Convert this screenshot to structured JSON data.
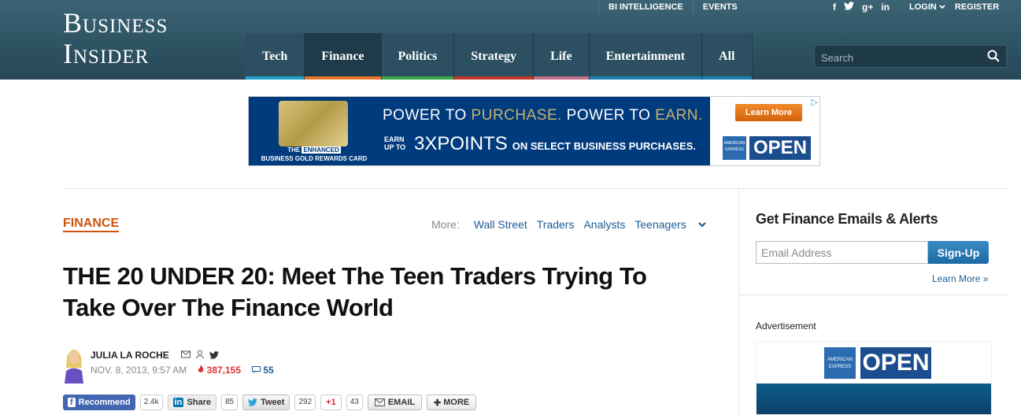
{
  "header": {
    "logo_line1": "Business",
    "logo_line2": "Insider",
    "top_links": [
      "BI INTELLIGENCE",
      "EVENTS"
    ],
    "social": [
      "f",
      "t",
      "g+",
      "in"
    ],
    "login": "LOGIN",
    "register": "REGISTER",
    "nav": [
      {
        "label": "Tech",
        "color": "#1fa0c8"
      },
      {
        "label": "Finance",
        "color": "#e8752a"
      },
      {
        "label": "Politics",
        "color": "#3aa44a"
      },
      {
        "label": "Strategy",
        "color": "#c0392b"
      },
      {
        "label": "Life",
        "color": "#c4708a"
      },
      {
        "label": "Entertainment",
        "color": "#1f7fb0"
      },
      {
        "label": "All",
        "color": "#1f7fb0"
      }
    ],
    "search_placeholder": "Search"
  },
  "ad": {
    "enhanced_prefix": "THE",
    "enhanced_box": "ENHANCED",
    "card_name": "BUSINESS GOLD REWARDS CARD",
    "line1_a": "POWER TO ",
    "line1_b": "PURCHASE.",
    "line1_c": " POWER TO ",
    "line1_d": "EARN.",
    "earn_up_1": "EARN",
    "earn_up_2": "UP TO",
    "big": "3X",
    "points": "POINTS",
    "small": "ON SELECT BUSINESS PURCHASES.",
    "learn_more": "Learn More",
    "open": "OPEN",
    "amex": "AMERICAN EXPRESS"
  },
  "article": {
    "section": "FINANCE",
    "more_label": "More:",
    "more_links": [
      "Wall Street",
      "Traders",
      "Analysts",
      "Teenagers"
    ],
    "title": "THE 20 UNDER 20: Meet The Teen Traders Trying To Take Over The Finance World",
    "author": "JULIA LA ROCHE",
    "date": "NOV. 8, 2013, 9:57 AM",
    "views": "387,155",
    "comments": "55"
  },
  "share": {
    "recommend": "Recommend",
    "recommend_count": "2.4k",
    "linkedin": "Share",
    "linkedin_count": "85",
    "tweet": "Tweet",
    "tweet_count": "292",
    "gplus": "+1",
    "gplus_count": "43",
    "email": "EMAIL",
    "more": "MORE"
  },
  "sidebar": {
    "title": "Get Finance Emails & Alerts",
    "email_placeholder": "Email Address",
    "signup": "Sign-Up",
    "learn_more": "Learn More »",
    "advertisement": "Advertisement",
    "open": "OPEN",
    "amex": "AMERICAN EXPRESS"
  }
}
